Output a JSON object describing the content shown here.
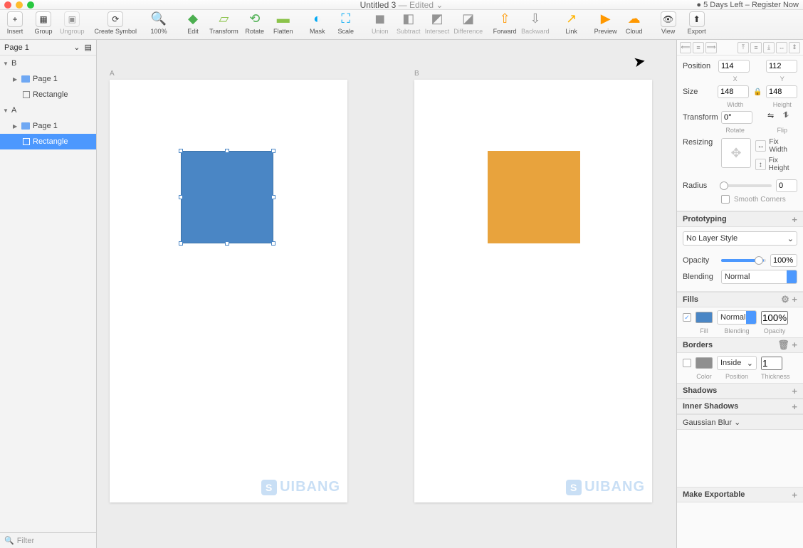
{
  "titlebar": {
    "filename": "Untitled 3",
    "status": "— Edited",
    "trial": "5 Days Left",
    "register": "Register Now"
  },
  "toolbar": {
    "insert": "Insert",
    "group": "Group",
    "ungroup": "Ungroup",
    "create_symbol": "Create Symbol",
    "zoom": "100%",
    "edit": "Edit",
    "transform": "Transform",
    "rotate": "Rotate",
    "flatten": "Flatten",
    "mask": "Mask",
    "scale": "Scale",
    "union": "Union",
    "subtract": "Subtract",
    "intersect": "Intersect",
    "difference": "Difference",
    "forward": "Forward",
    "backward": "Backward",
    "link": "Link",
    "preview": "Preview",
    "cloud": "Cloud",
    "view": "View",
    "export": "Export"
  },
  "sidebar": {
    "page_selector": "Page 1",
    "layers": [
      {
        "type": "symbol",
        "label": "B",
        "arrow": "▼"
      },
      {
        "type": "page",
        "label": "Page 1",
        "arrow": "▶",
        "indent": 1,
        "folder": true
      },
      {
        "type": "rect",
        "label": "Rectangle",
        "indent": 2
      },
      {
        "type": "symbol",
        "label": "A",
        "arrow": "▼"
      },
      {
        "type": "page",
        "label": "Page 1",
        "arrow": "▶",
        "indent": 1,
        "folder": true
      },
      {
        "type": "rect",
        "label": "Rectangle",
        "indent": 2,
        "selected": true
      }
    ],
    "filter_placeholder": "Filter"
  },
  "canvas": {
    "artboard_a": "A",
    "artboard_b": "B",
    "watermark": "UIBANG"
  },
  "inspector": {
    "position_label": "Position",
    "x": "114",
    "y": "112",
    "x_lbl": "X",
    "y_lbl": "Y",
    "size_label": "Size",
    "w": "148",
    "h": "148",
    "w_lbl": "Width",
    "h_lbl": "Height",
    "transform_label": "Transform",
    "rotate": "0°",
    "rotate_lbl": "Rotate",
    "flip_lbl": "Flip",
    "resizing_label": "Resizing",
    "fix_width": "Fix Width",
    "fix_height": "Fix Height",
    "radius_label": "Radius",
    "radius_val": "0",
    "smooth": "Smooth Corners",
    "prototyping": "Prototyping",
    "no_layer_style": "No Layer Style",
    "opacity_label": "Opacity",
    "opacity_val": "100%",
    "blending_label": "Blending",
    "blending_val": "Normal",
    "fills": "Fills",
    "fill_blend": "Normal",
    "fill_op": "100%",
    "fill_lbl": "Fill",
    "blend_lbl": "Blending",
    "op_lbl": "Opacity",
    "borders": "Borders",
    "border_pos": "Inside",
    "border_thick": "1",
    "color_lbl": "Color",
    "pos_lbl": "Position",
    "thick_lbl": "Thickness",
    "shadows": "Shadows",
    "inner_shadows": "Inner Shadows",
    "gaussian": "Gaussian Blur",
    "make_exportable": "Make Exportable"
  },
  "colors": {
    "blue_shape": "#4a86c5",
    "orange_shape": "#e8a33d",
    "fill_swatch": "#4a86c5",
    "border_swatch": "#8f8f8f"
  }
}
